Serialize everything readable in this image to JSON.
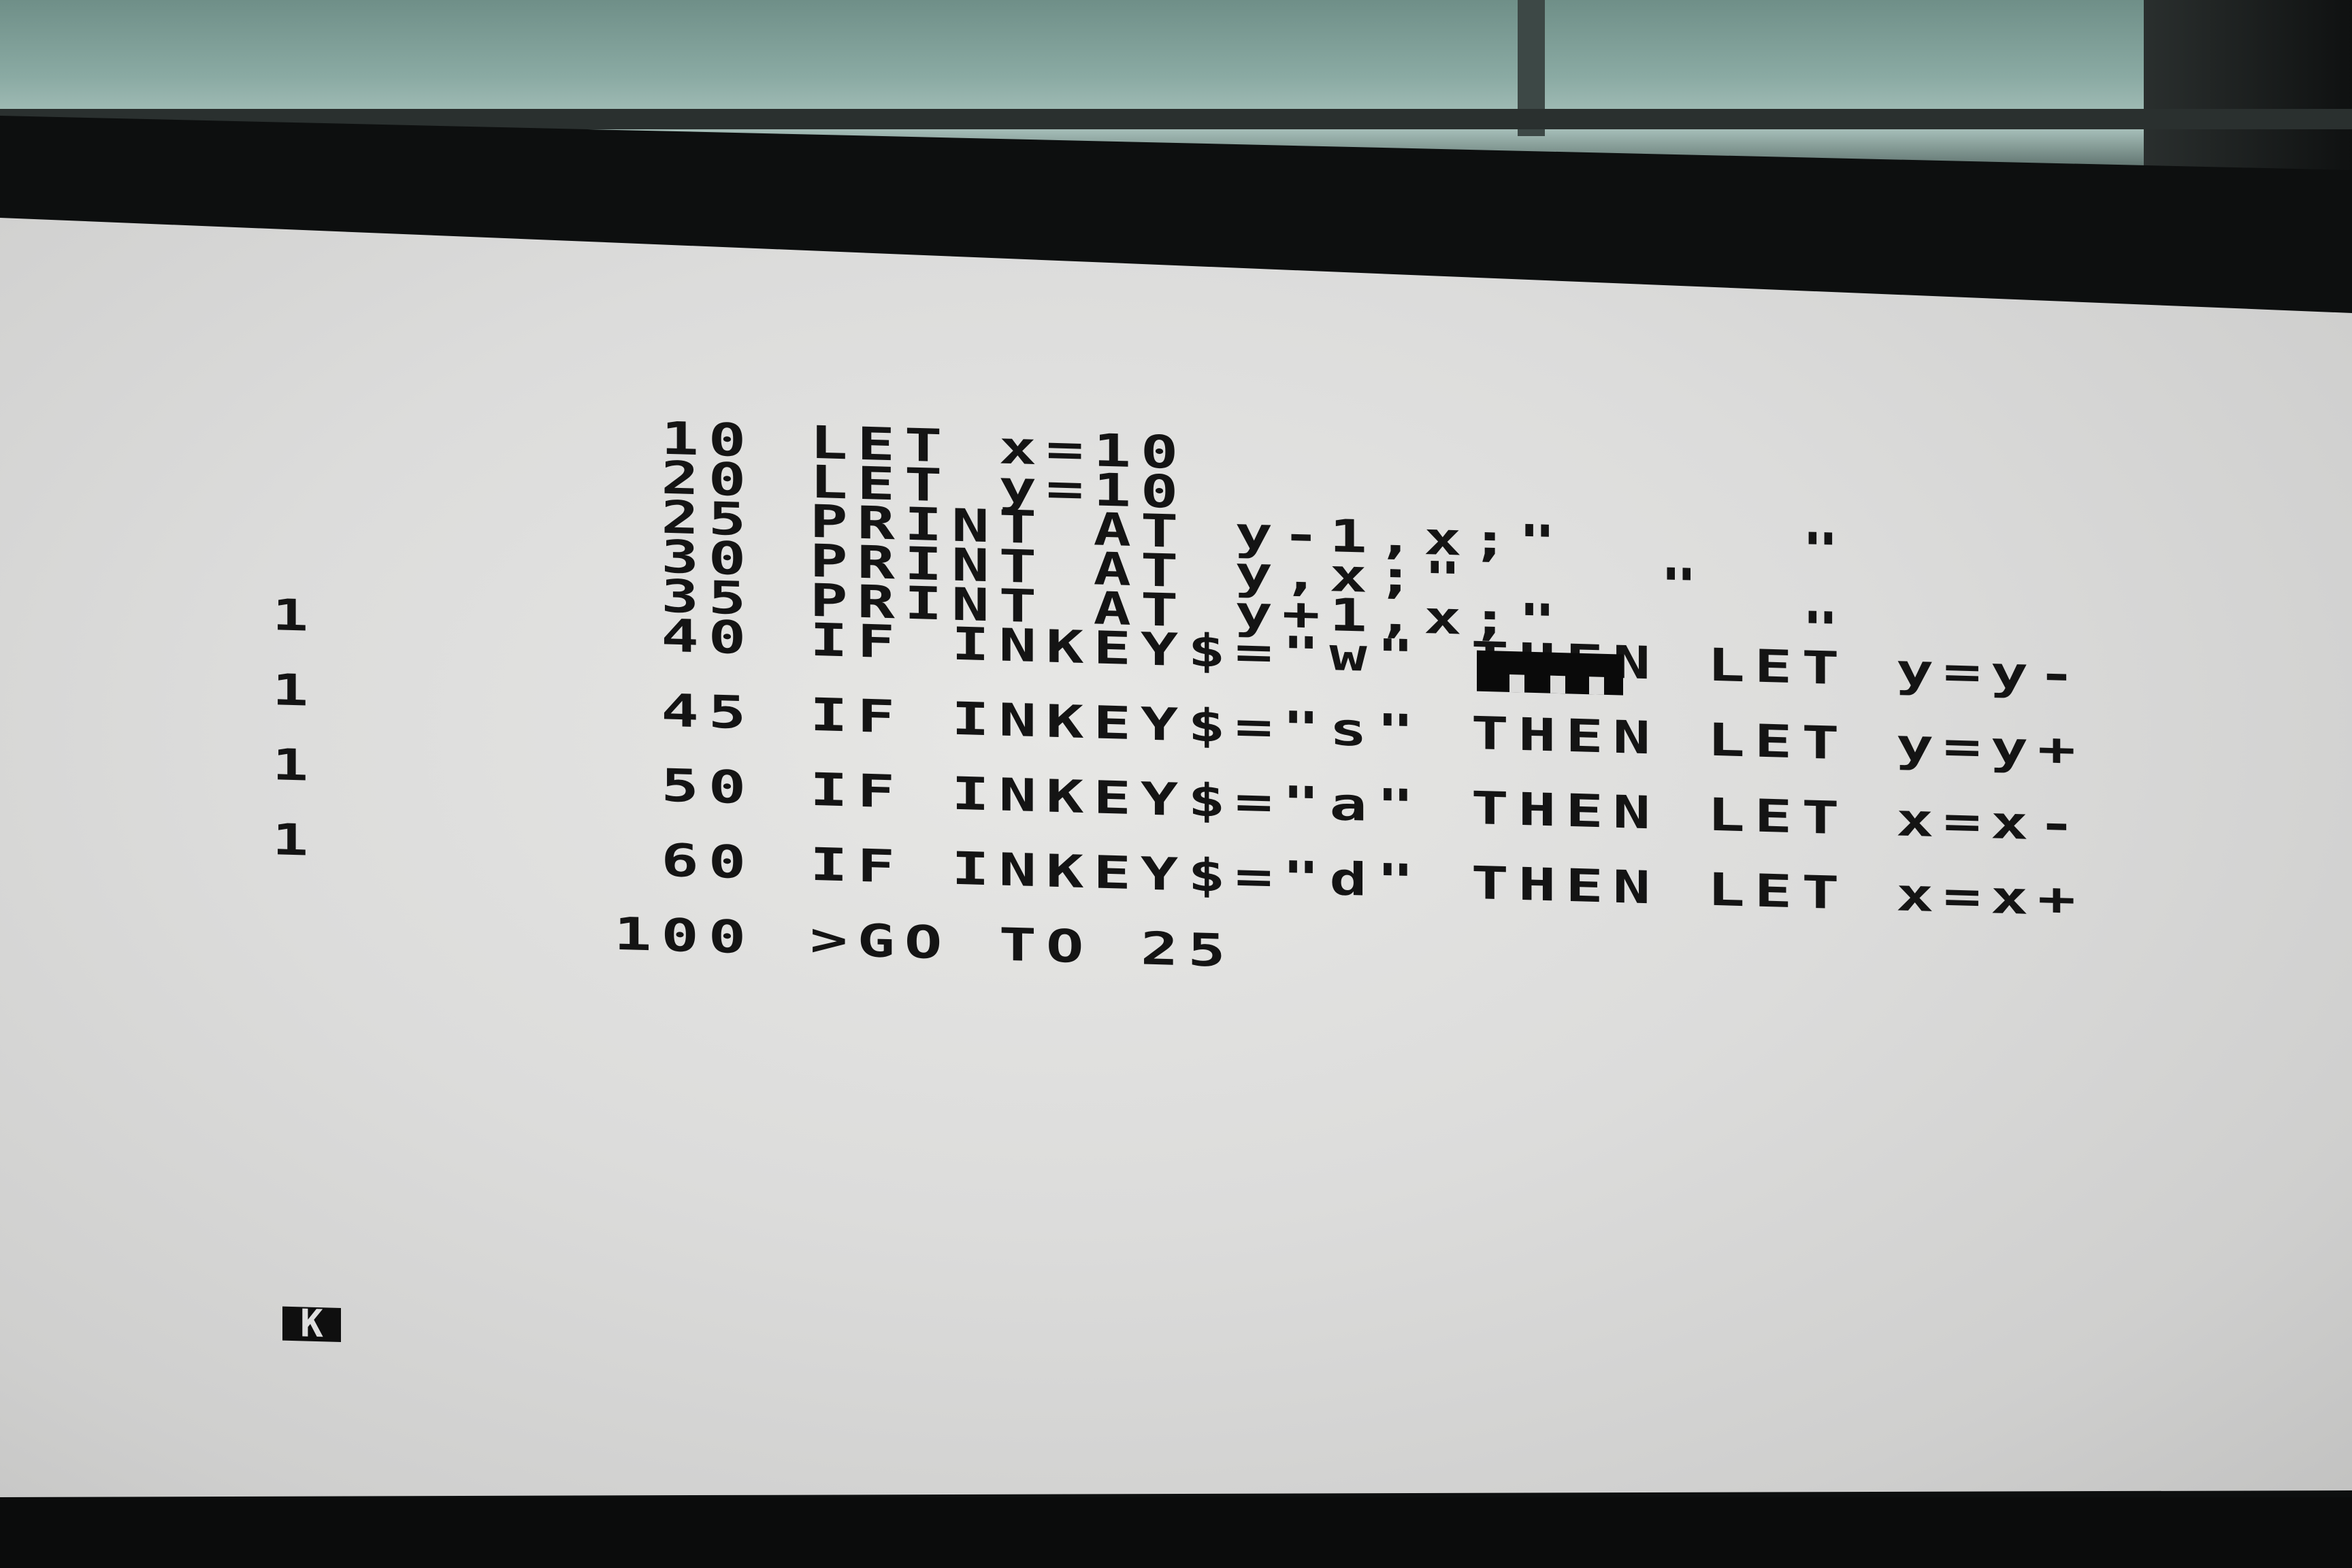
{
  "program": {
    "lines": [
      {
        "number": "10",
        "code": "LET x=10"
      },
      {
        "number": "20",
        "code": "LET y=10"
      },
      {
        "number": "25",
        "code": "PRINT AT y-1,x;\"     \""
      },
      {
        "number": "30",
        "code": "PRINT AT y,x;\"    \""
      },
      {
        "number": "35",
        "code": "PRINT AT y+1,x;\"     \""
      },
      {
        "number": "40",
        "code": "IF INKEY$=\"w\" THEN LET y=y-"
      },
      {
        "number": "45",
        "code": "IF INKEY$=\"s\" THEN LET y=y+"
      },
      {
        "number": "50",
        "code": "IF INKEY$=\"a\" THEN LET x=x-"
      },
      {
        "number": "60",
        "code": "IF INKEY$=\"d\" THEN LET x=x+"
      },
      {
        "number": "100",
        "code": ">GO TO 25"
      }
    ],
    "continuations": [
      "1",
      "1",
      "1",
      "1"
    ]
  },
  "cursor": {
    "mode": "K"
  },
  "colors": {
    "screen_bg": "#dcdcdb",
    "ink": "#141414",
    "bezel": "#0d0f0f"
  }
}
